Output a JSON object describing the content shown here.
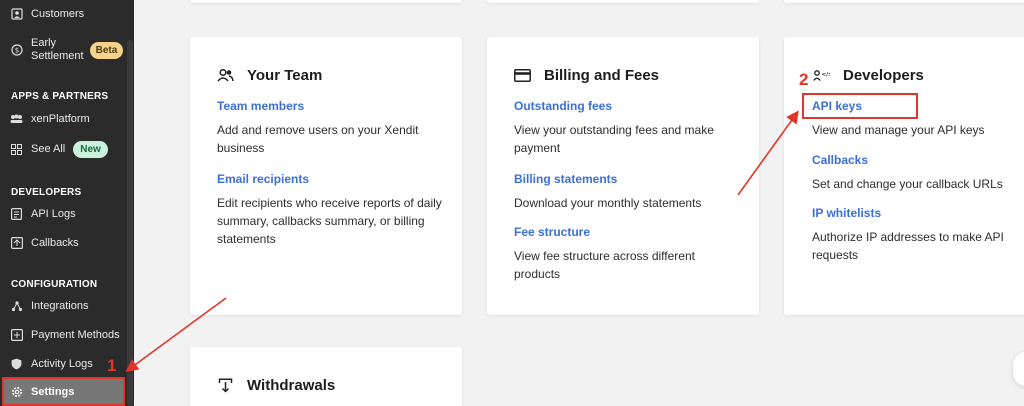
{
  "sidebar": {
    "items": [
      {
        "label": "Customers",
        "icon": "customers-icon"
      },
      {
        "label": "Early Settlement",
        "line1": "Early",
        "line2": "Settlement",
        "badge": "Beta",
        "icon": "settlement-icon"
      },
      {
        "label": "xenPlatform",
        "icon": "platform-icon"
      },
      {
        "label": "See All",
        "badge": "New",
        "icon": "grid-icon"
      },
      {
        "label": "API Logs",
        "icon": "api-logs-icon"
      },
      {
        "label": "Callbacks",
        "icon": "callbacks-icon"
      },
      {
        "label": "Integrations",
        "icon": "integrations-icon"
      },
      {
        "label": "Payment Methods",
        "icon": "payment-methods-icon"
      },
      {
        "label": "Activity Logs",
        "icon": "shield-icon"
      },
      {
        "label": "Settings",
        "icon": "gear-icon",
        "active": true
      }
    ],
    "sections": {
      "apps": "APPS & PARTNERS",
      "developers": "DEVELOPERS",
      "configuration": "CONFIGURATION"
    }
  },
  "cards": {
    "team": {
      "title": "Your Team",
      "link1": "Team members",
      "desc1_l1": "Add and remove users on your Xendit",
      "desc1_l2": "business",
      "link2": "Email recipients",
      "desc2_l1": "Edit recipients who receive reports of daily",
      "desc2_l2": "summary, callbacks summary, or billing",
      "desc2_l3": "statements"
    },
    "billing": {
      "title": "Billing and Fees",
      "link1": "Outstanding fees",
      "desc1_l1": "View your outstanding fees and make",
      "desc1_l2": "payment",
      "link2": "Billing statements",
      "desc2_l1": "Download your monthly statements",
      "link3": "Fee structure",
      "desc3_l1": "View fee structure across different",
      "desc3_l2": "products"
    },
    "developers": {
      "title": "Developers",
      "link1": "API keys",
      "desc1_l1": "View and manage your API keys",
      "link2": "Callbacks",
      "desc2_l1": "Set and change your callback URLs",
      "link3": "IP whitelists",
      "desc3_l1": "Authorize IP addresses to make API",
      "desc3_l2": "requests"
    },
    "withdrawals": {
      "title": "Withdrawals"
    }
  },
  "annotations": {
    "step1": "1",
    "step2": "2",
    "color": "#e0352b"
  },
  "colors": {
    "sidebar_bg": "#2b2b2b",
    "link": "#3b6fd8",
    "page_bg": "#f2f2f3"
  }
}
